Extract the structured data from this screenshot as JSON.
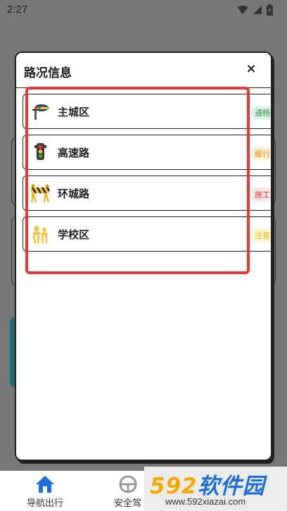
{
  "status_bar": {
    "time": "2:27"
  },
  "dialog": {
    "title": "路况信息",
    "close_symbol": "×",
    "items": [
      {
        "name": "主城区",
        "status": "通畅",
        "status_color": "#2e9a48",
        "badge_bg": "#e6f5ea",
        "icon": "traffic-police-icon"
      },
      {
        "name": "高速路",
        "status": "缓行",
        "status_color": "#f08c00",
        "badge_bg": "#fff1e0",
        "icon": "traffic-light-icon"
      },
      {
        "name": "环城路",
        "status": "施工",
        "status_color": "#e53935",
        "badge_bg": "#fde8e8",
        "icon": "construction-barrier-icon"
      },
      {
        "name": "学校区",
        "status": "注意",
        "status_color": "#f2b400",
        "badge_bg": "#fff6d8",
        "icon": "school-children-icon"
      }
    ]
  },
  "bottom_nav": {
    "items": [
      {
        "label": "导航出行",
        "icon": "home-icon"
      },
      {
        "label": "安全驾",
        "icon": "steering-wheel-icon"
      }
    ]
  },
  "watermark": {
    "logo_num": "592",
    "logo_text": "软件园",
    "url": "www.592xiazai.com"
  },
  "colors": {
    "highlight": "#e53935",
    "nav_accent": "#1e6fd9"
  }
}
